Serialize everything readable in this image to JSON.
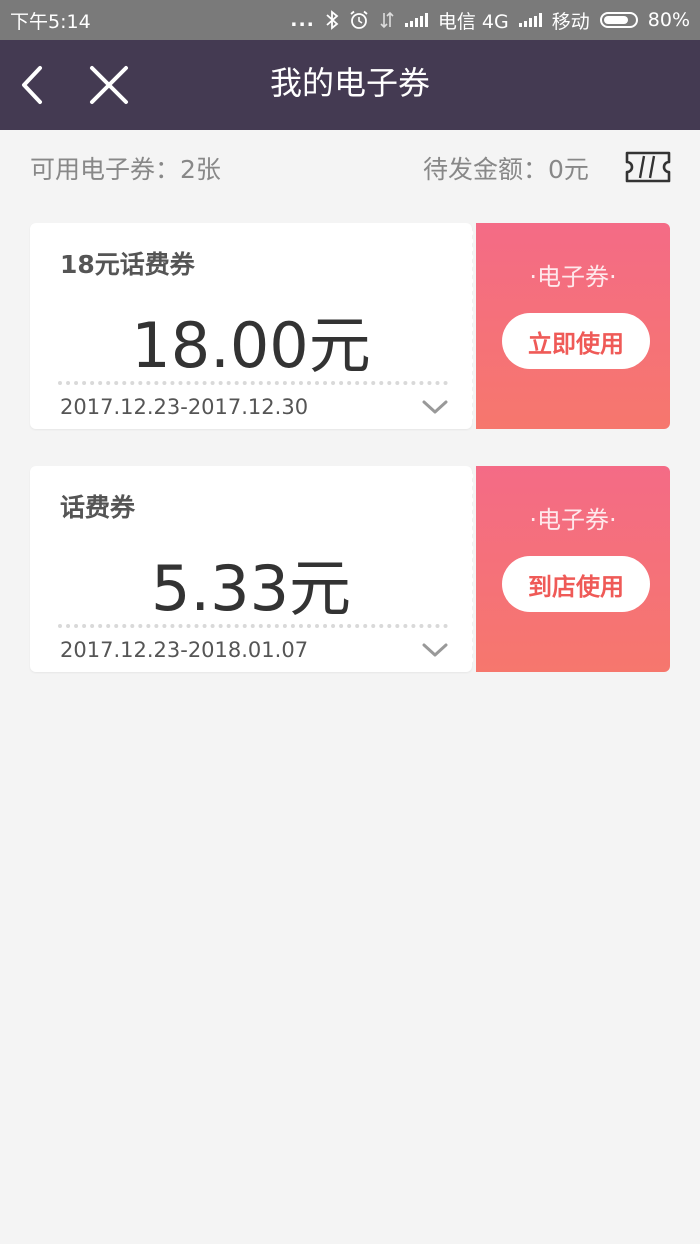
{
  "status_bar": {
    "time": "下午5:14",
    "dots": "...",
    "carrier1": "电信 4G",
    "carrier2": "移动",
    "battery_percent": "80%",
    "battery_level": 0.8,
    "icons": [
      "bluetooth-icon",
      "alarm-icon",
      "data-transfer-icon",
      "signal-icon",
      "battery-icon"
    ]
  },
  "navbar": {
    "title": "我的电子券",
    "back_icon": "chevron-left-icon",
    "close_icon": "close-icon"
  },
  "summary": {
    "available": "可用电子券：2张",
    "pending": "待发金额：0元",
    "icon": "ticket-icon"
  },
  "coupons": [
    {
      "name": "18元话费券",
      "amount": "18.00元",
      "period": "2017.12.23-2017.12.30",
      "stub_label": "·电子券·",
      "button_label": "立即使用"
    },
    {
      "name": "话费券",
      "amount": "5.33元",
      "period": "2017.12.23-2018.01.07",
      "stub_label": "·电子券·",
      "button_label": "到店使用"
    }
  ],
  "colors": {
    "navbar_bg": "#443a52",
    "stub_gradient_top": "#f46b86",
    "stub_gradient_bottom": "#f6776d",
    "button_text": "#ef5a57",
    "page_bg": "#f4f4f4"
  }
}
